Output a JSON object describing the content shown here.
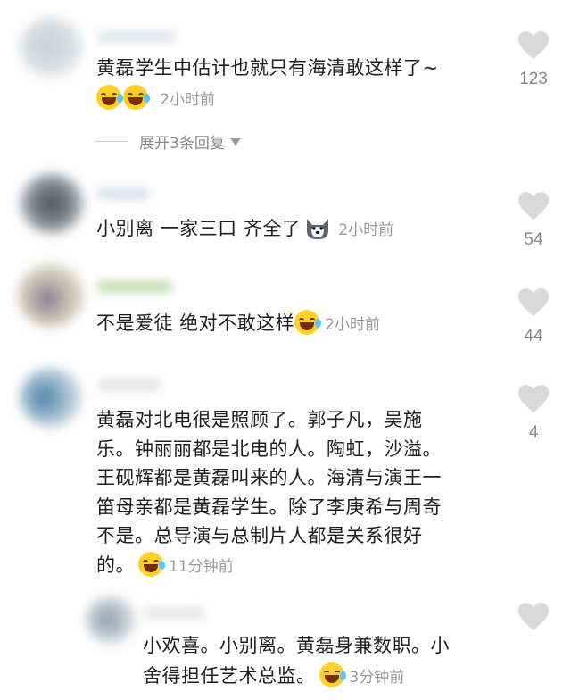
{
  "comments": [
    {
      "text": "黄磊学生中估计也就只有海清敢这样了~",
      "time": "2小时前",
      "likes": "123",
      "emojis": [
        "cry-laugh-emoji",
        "cry-laugh-emoji"
      ]
    },
    {
      "text": "小别离 一家三口 齐全了",
      "time": "2小时前",
      "likes": "54",
      "emojis": [
        "husky-dog-emoji"
      ]
    },
    {
      "text": "不是爱徒 绝对不敢这样",
      "time": "2小时前",
      "likes": "44",
      "emojis": [
        "cry-laugh-emoji"
      ]
    },
    {
      "lines": [
        "黄磊对北电很是照顾了。郭子凡，吴施",
        "乐。钟丽丽都是北电的人。陶虹，沙溢。",
        "王砚辉都是黄磊叫来的人。海清与演王一",
        "笛母亲都是黄磊学生。除了李庚希与周奇",
        "不是。总导演与总制片人都是关系很好",
        "的。"
      ],
      "time": "11分钟前",
      "likes": "4",
      "emojis": [
        "cry-laugh-emoji"
      ]
    },
    {
      "lines": [
        "小欢喜。小别离。黄磊身兼数职。小",
        "舍得担任艺术总监。"
      ],
      "time": "3分钟前",
      "likes": "",
      "emojis": [
        "cry-laugh-emoji"
      ]
    }
  ],
  "expand_replies": "展开3条回复",
  "colors": {
    "text": "#1e1e1e",
    "meta": "#9a9a9a",
    "heart": "#d9d9d9",
    "emoji": "#ffcf2a"
  }
}
